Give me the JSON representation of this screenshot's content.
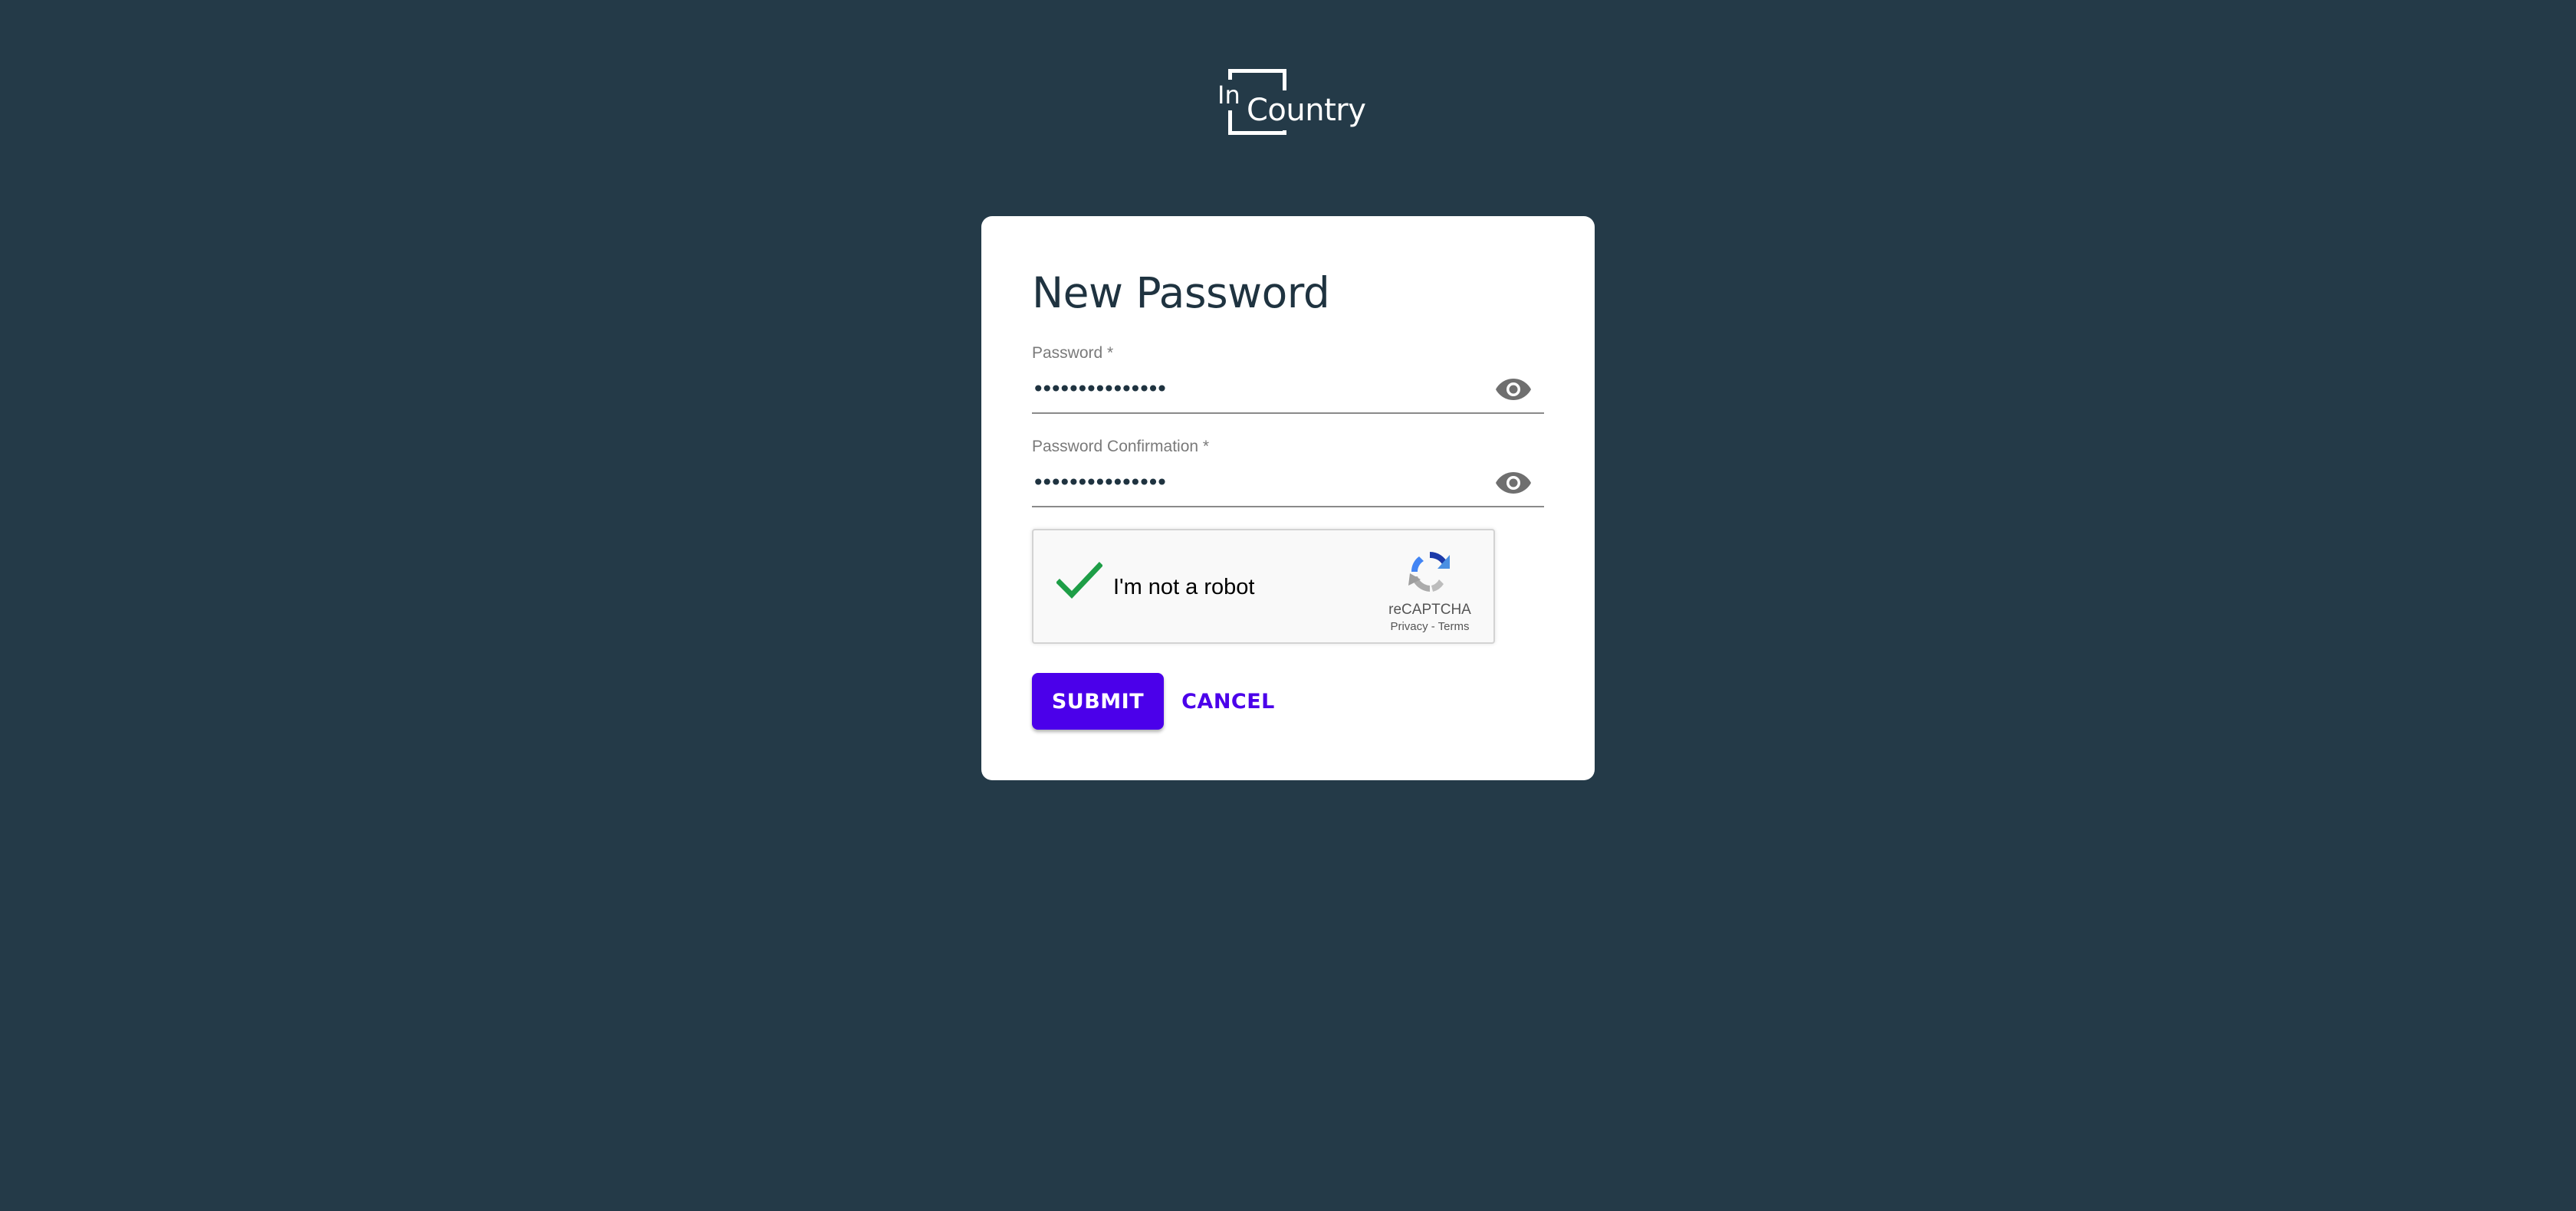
{
  "logo": {
    "in": "In",
    "country": "Country"
  },
  "form": {
    "title": "New Password",
    "password": {
      "label": "Password *",
      "value": "•••••••••••••••",
      "toggle_icon": "eye-icon"
    },
    "password_confirmation": {
      "label": "Password Confirmation *",
      "value": "•••••••••••••••",
      "toggle_icon": "eye-icon"
    },
    "captcha": {
      "checked": true,
      "label": "I'm not a robot",
      "brand": "reCAPTCHA",
      "links": "Privacy - Terms"
    },
    "submit_label": "SUBMIT",
    "cancel_label": "CANCEL"
  },
  "colors": {
    "background": "#243a48",
    "accent": "#4b00ea",
    "check": "#1e9e47"
  }
}
